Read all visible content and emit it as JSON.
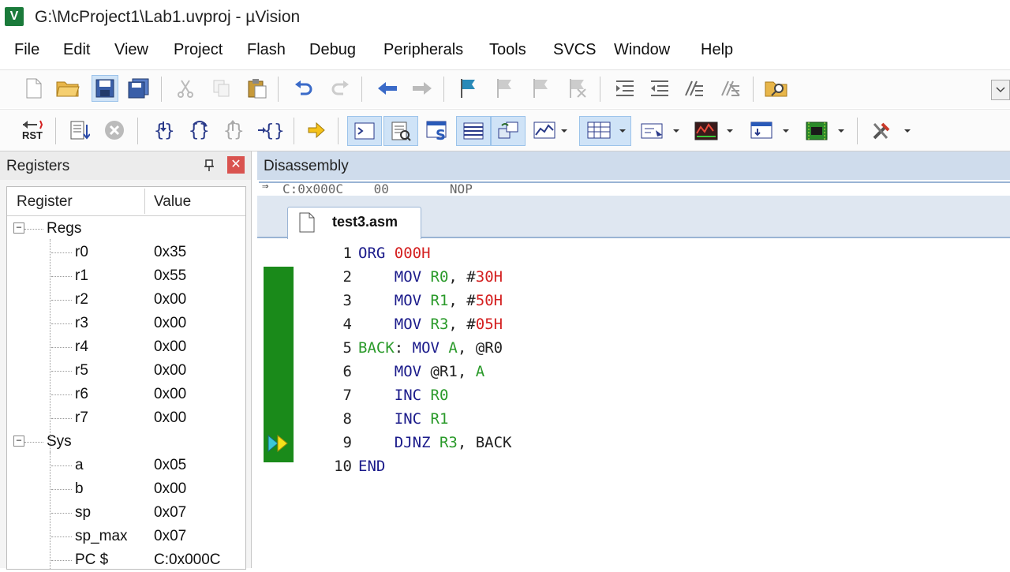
{
  "window": {
    "title": "G:\\McProject1\\Lab1.uvproj - µVision",
    "logo": "V"
  },
  "menu": [
    "File",
    "Edit",
    "View",
    "Project",
    "Flash",
    "Debug",
    "Peripherals",
    "Tools",
    "SVCS",
    "Window",
    "Help"
  ],
  "toolbar2": {
    "reset_label": "RST"
  },
  "registers_panel": {
    "title": "Registers",
    "col_register": "Register",
    "col_value": "Value",
    "groups": [
      {
        "name": "Regs",
        "expander": "−",
        "items": [
          {
            "name": "r0",
            "value": "0x35"
          },
          {
            "name": "r1",
            "value": "0x55"
          },
          {
            "name": "r2",
            "value": "0x00"
          },
          {
            "name": "r3",
            "value": "0x00"
          },
          {
            "name": "r4",
            "value": "0x00"
          },
          {
            "name": "r5",
            "value": "0x00"
          },
          {
            "name": "r6",
            "value": "0x00"
          },
          {
            "name": "r7",
            "value": "0x00"
          }
        ]
      },
      {
        "name": "Sys",
        "expander": "−",
        "items": [
          {
            "name": "a",
            "value": "0x05"
          },
          {
            "name": "b",
            "value": "0x00"
          },
          {
            "name": "sp",
            "value": "0x07"
          },
          {
            "name": "sp_max",
            "value": "0x07"
          },
          {
            "name": "PC  $",
            "value": "C:0x000C"
          }
        ]
      }
    ]
  },
  "disassembly": {
    "title": "Disassembly",
    "cut_line": "C:0x000C    00        NOP"
  },
  "editor": {
    "tab": "test3.asm",
    "lines": [
      {
        "n": "1",
        "parts": [
          [
            "kw",
            "ORG "
          ],
          [
            "num",
            "000H"
          ]
        ]
      },
      {
        "n": "2",
        "parts": [
          [
            "txt",
            "    "
          ],
          [
            "kw",
            "MOV "
          ],
          [
            "reg",
            "R0"
          ],
          [
            "txt",
            ", #"
          ],
          [
            "num",
            "30H"
          ]
        ]
      },
      {
        "n": "3",
        "parts": [
          [
            "txt",
            "    "
          ],
          [
            "kw",
            "MOV "
          ],
          [
            "reg",
            "R1"
          ],
          [
            "txt",
            ", #"
          ],
          [
            "num",
            "50H"
          ]
        ]
      },
      {
        "n": "4",
        "parts": [
          [
            "txt",
            "    "
          ],
          [
            "kw",
            "MOV "
          ],
          [
            "reg",
            "R3"
          ],
          [
            "txt",
            ", #"
          ],
          [
            "num",
            "05H"
          ]
        ]
      },
      {
        "n": "5",
        "parts": [
          [
            "lbl",
            "BACK"
          ],
          [
            "txt",
            ": "
          ],
          [
            "kw",
            "MOV "
          ],
          [
            "reg",
            "A"
          ],
          [
            "txt",
            ", @R0"
          ]
        ]
      },
      {
        "n": "6",
        "parts": [
          [
            "txt",
            "    "
          ],
          [
            "kw",
            "MOV "
          ],
          [
            "txt",
            "@R1, "
          ],
          [
            "reg",
            "A"
          ]
        ]
      },
      {
        "n": "7",
        "parts": [
          [
            "txt",
            "    "
          ],
          [
            "kw",
            "INC "
          ],
          [
            "reg",
            "R0"
          ]
        ]
      },
      {
        "n": "8",
        "parts": [
          [
            "txt",
            "    "
          ],
          [
            "kw",
            "INC "
          ],
          [
            "reg",
            "R1"
          ]
        ]
      },
      {
        "n": "9",
        "parts": [
          [
            "txt",
            "    "
          ],
          [
            "kw",
            "DJNZ "
          ],
          [
            "reg",
            "R3"
          ],
          [
            "txt",
            ", BACK"
          ]
        ]
      },
      {
        "n": "10",
        "parts": [
          [
            "kw",
            "END"
          ]
        ]
      }
    ],
    "current_line": "9"
  },
  "colors": {
    "gutter": "#1a8a1a",
    "keyword": "#1a1a8a",
    "number": "#d42020",
    "register": "#2a9a2a",
    "accent": "#cfdcec"
  }
}
